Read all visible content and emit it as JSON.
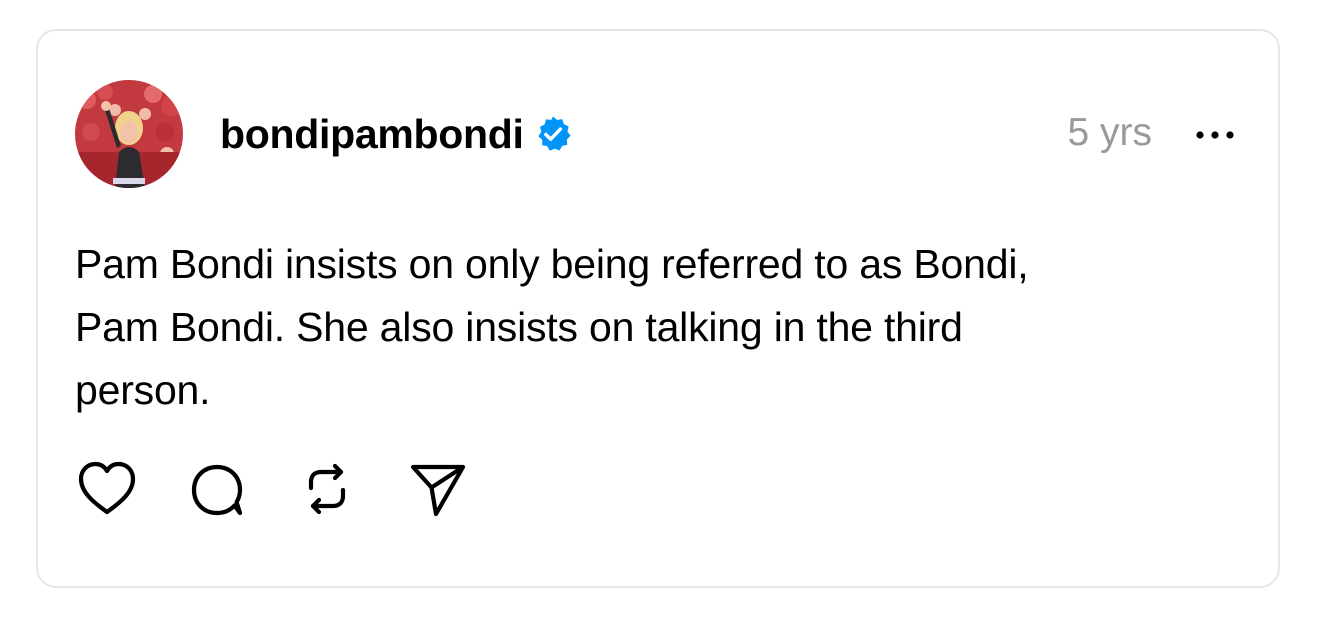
{
  "post": {
    "username": "bondipambondi",
    "verified": true,
    "timestamp": "5 yrs",
    "text_lines": [
      "Pam Bondi insists on only being referred to as Bondi,",
      "Pam Bondi. She also insists on talking in the third",
      "person."
    ]
  },
  "icons": {
    "verified": "verified-badge-icon",
    "more": "more-options-icon",
    "like": "heart-icon",
    "reply": "comment-icon",
    "repost": "repost-icon",
    "share": "send-icon"
  },
  "colors": {
    "verified_blue": "#0095f6",
    "timestamp_gray": "#999999",
    "card_border": "#e6e6e6"
  }
}
